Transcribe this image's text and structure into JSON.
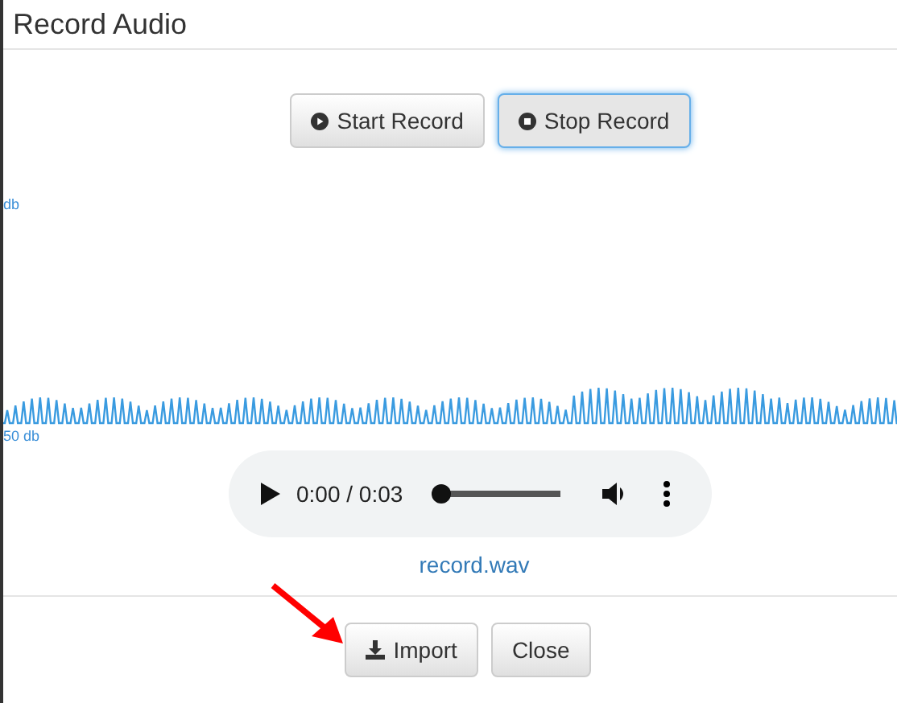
{
  "window": {
    "title": "Record Audio"
  },
  "record_buttons": [
    {
      "label": "Start Record",
      "kind": "play",
      "selected": false
    },
    {
      "label": "Stop Record",
      "kind": "stop",
      "selected": true
    }
  ],
  "waveform": {
    "top_label": "db",
    "bottom_label": "50 db"
  },
  "player": {
    "time": "0:00 / 0:03",
    "level": 0
  },
  "file_link": "record.wav",
  "footer_buttons": [
    {
      "label": "Import",
      "kind": "download"
    },
    {
      "label": "Close",
      "kind": "plain"
    }
  ]
}
